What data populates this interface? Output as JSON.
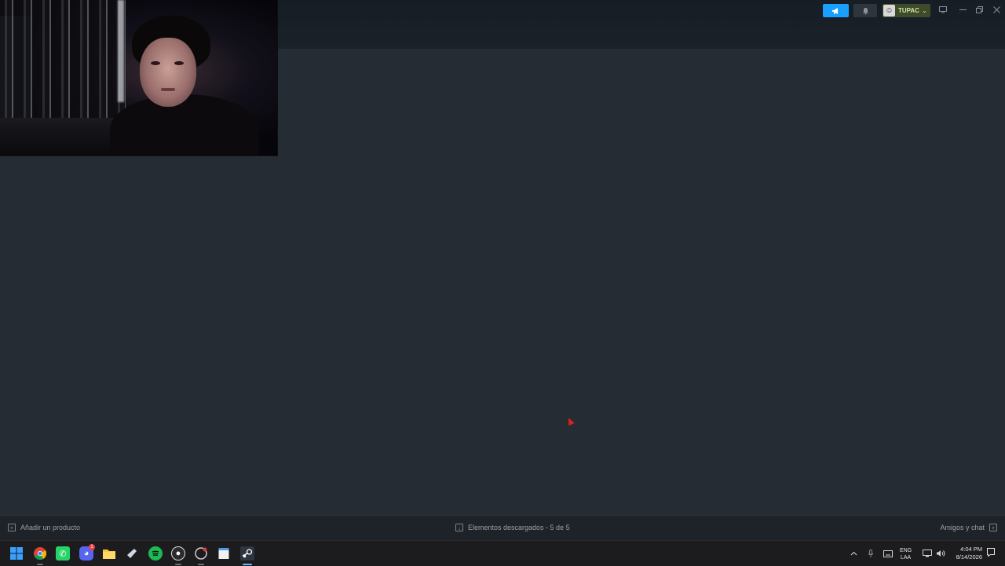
{
  "titlebar": {
    "announce_icon": "megaphone-icon",
    "bell_icon": "bell-icon",
    "user": {
      "name": "TUPAC",
      "chevron": "⌄"
    },
    "window_controls": [
      "monitor-icon",
      "minimize-icon",
      "restore-icon",
      "close-icon"
    ]
  },
  "footer": {
    "add_product": "Añadir un producto",
    "downloads": "Elementos descargados - 5 de 5",
    "friends_chat": "Amigos y chat"
  },
  "taskbar": {
    "apps": [
      "windows-start",
      "chrome",
      "whatsapp",
      "discord",
      "file-explorer",
      "steam-alt",
      "spotify",
      "obs",
      "github-desktop",
      "notepad",
      "steam"
    ],
    "discord_badge": "1",
    "language": {
      "line1": "ENG",
      "line2": "LAA"
    },
    "clock": {
      "time": "4:04 PM",
      "date": "8/14/2026"
    }
  },
  "colors": {
    "accent_blue": "#1a9fff",
    "user_green": "#3f4a2b",
    "background": "#262c33"
  }
}
